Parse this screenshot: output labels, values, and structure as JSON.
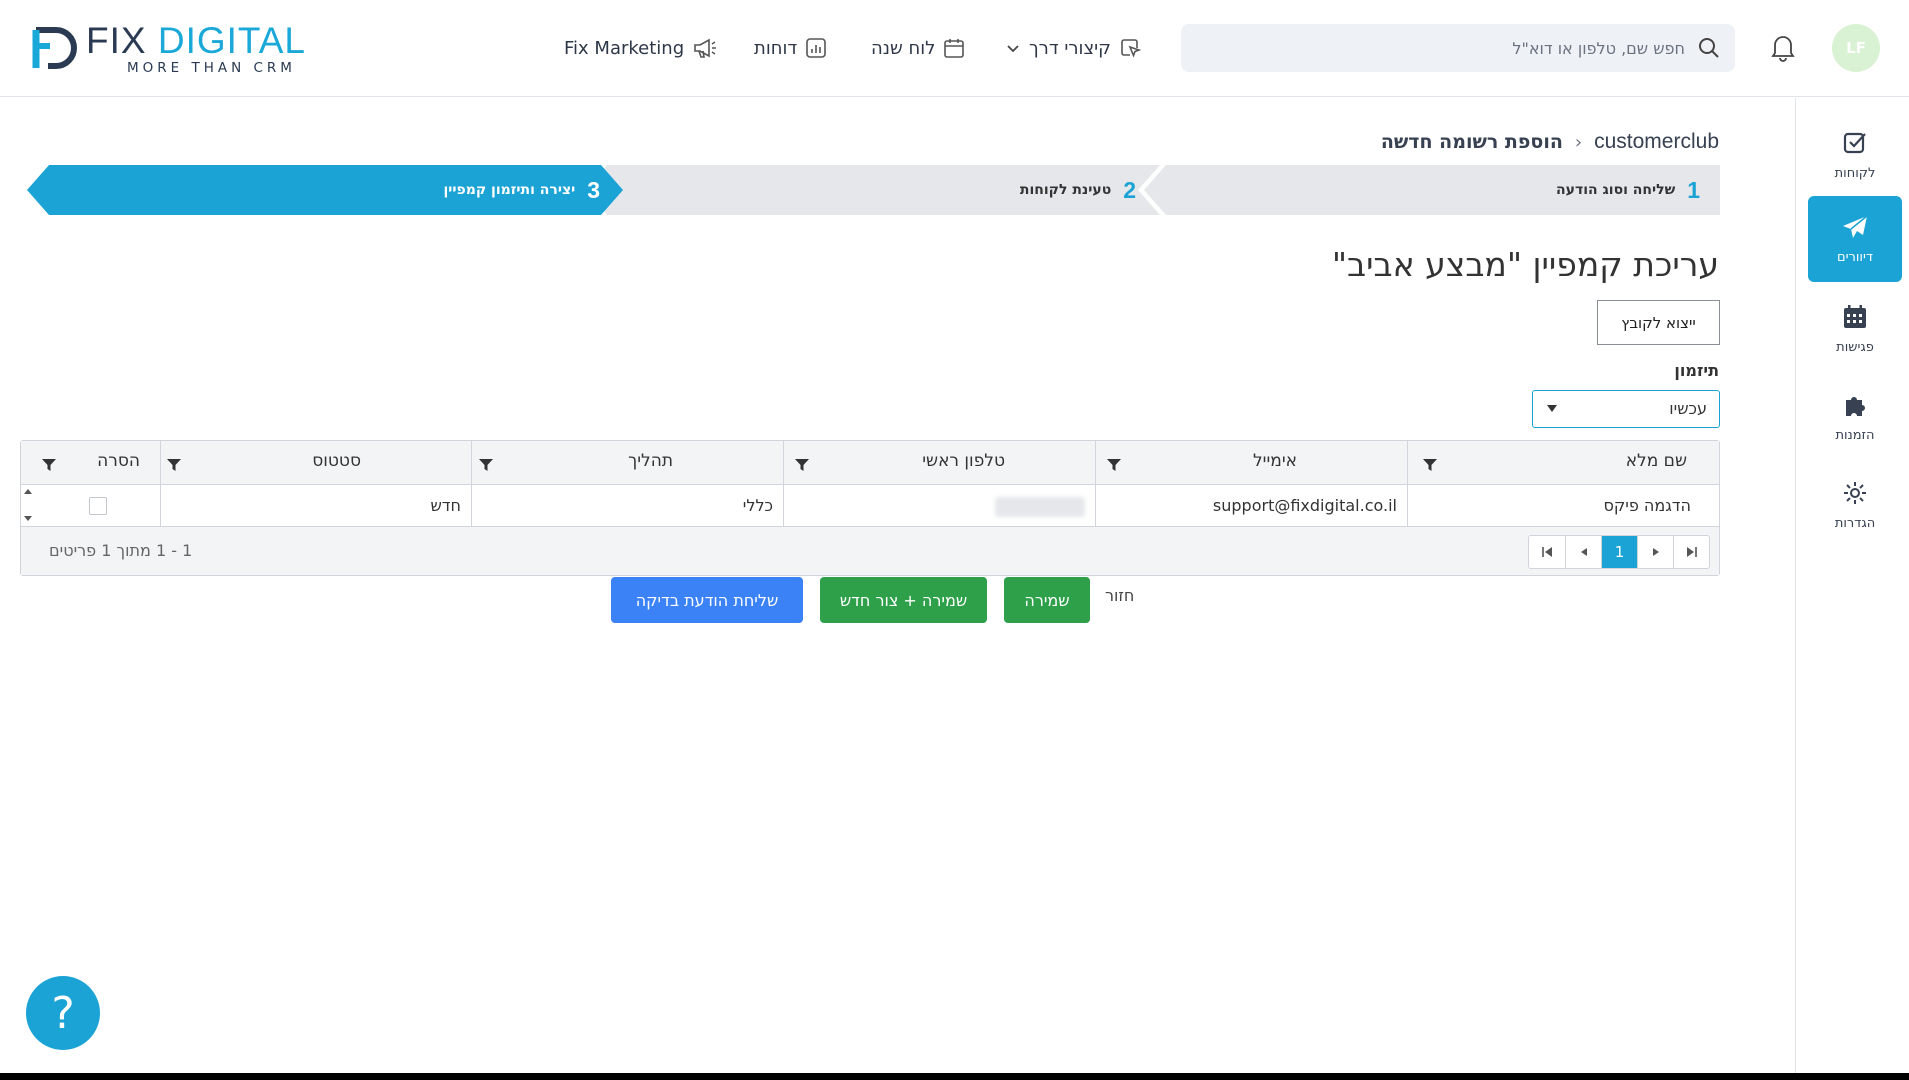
{
  "logo": {
    "brand_a": "FIX ",
    "brand_b": "DIGITAL",
    "tagline": "MORE THAN CRM"
  },
  "topnav": {
    "marketing": "Fix Marketing",
    "reports": "דוחות",
    "calendar": "לוח שנה",
    "shortcuts": "קיצורי דרך"
  },
  "search": {
    "placeholder": "חפש שם, טלפון או דוא\"ל",
    "value": ""
  },
  "user": {
    "initials": "LF"
  },
  "sidebar": {
    "items": [
      {
        "label": "לקוחות",
        "icon": "check-square-icon"
      },
      {
        "label": "דיוורים",
        "icon": "paper-plane-icon"
      },
      {
        "label": "פגישות",
        "icon": "calendar-icon"
      },
      {
        "label": "הזמנות",
        "icon": "puzzle-icon"
      },
      {
        "label": "הגדרות",
        "icon": "gear-icon"
      }
    ],
    "active": 1
  },
  "breadcrumb": {
    "root": "customerclub",
    "separator": "‹",
    "current": "הוספת רשומה חדשה"
  },
  "wizard": {
    "steps": [
      {
        "number": "1",
        "label": "שליחה וסוג הודעה"
      },
      {
        "number": "2",
        "label": "טעינת לקוחות"
      },
      {
        "number": "3",
        "label": "יצירה ותיזמון קמפיין"
      }
    ],
    "active": 3
  },
  "page": {
    "title": "עריכת קמפיין \"מבצע אביב\"",
    "export_label": "ייצוא לקובץ",
    "schedule_label": "תיזמון",
    "schedule_value": "עכשיו"
  },
  "grid": {
    "columns": [
      "שם מלא",
      "אימייל",
      "טלפון ראשי",
      "תהליך",
      "סטטוס",
      "הסרה"
    ],
    "rows": [
      {
        "name": "הדגמה פיקס",
        "email": "support@fixdigital.co.il",
        "phone": "",
        "process": "כללי",
        "status": "חדש",
        "removed": false
      }
    ],
    "pager_info": "1 - 1 מתוך 1 פריטים",
    "current_page": "1"
  },
  "actions": {
    "test": "שליחת הודעת בדיקה",
    "save_new": "שמירה + צור חדש",
    "save": "שמירה",
    "back": "חזור"
  },
  "help": {
    "label": "?"
  },
  "colors": {
    "accent": "#1ba3d5",
    "green": "#2ea04a",
    "blue": "#3b82f6",
    "wizard_inactive": "#e5e7eb"
  }
}
